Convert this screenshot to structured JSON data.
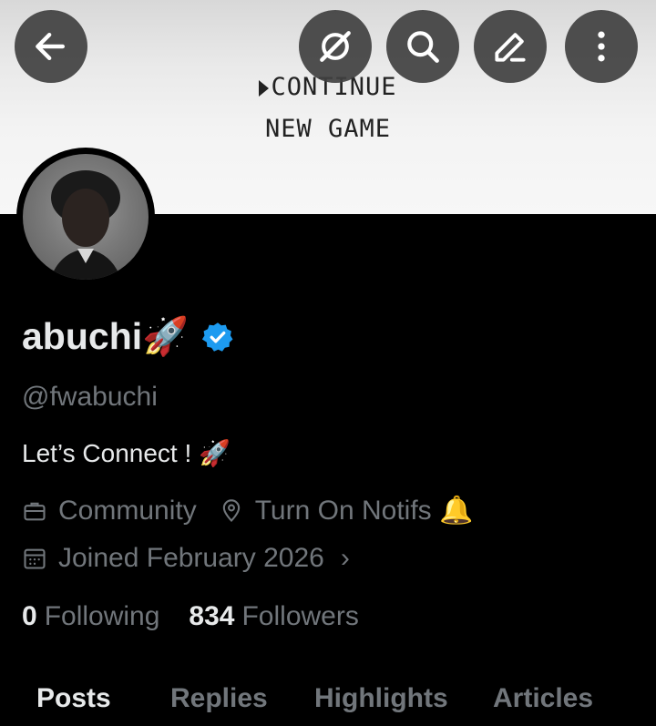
{
  "banner": {
    "line1": "CONTINUE",
    "line2": "NEW GAME"
  },
  "topbar": {
    "back_icon": "arrow-left-icon",
    "grok_icon": "grok-icon",
    "search_icon": "search-icon",
    "edit_icon": "pencil-icon",
    "more_icon": "more-vertical-icon"
  },
  "profile": {
    "name": "abuchi🚀",
    "handle": "@fwabuchi",
    "bio": "Let’s Connect ! 🚀",
    "category": "Community",
    "location": "Turn On Notifs 🔔",
    "joined": "Joined February 2026",
    "verified_color": "#1d9bf0"
  },
  "stats": {
    "following_count": "0",
    "following_label": "Following",
    "followers_count": "834",
    "followers_label": "Followers"
  },
  "tabs": [
    {
      "label": "Posts",
      "active": true
    },
    {
      "label": "Replies",
      "active": false
    },
    {
      "label": "Highlights",
      "active": false
    },
    {
      "label": "Articles",
      "active": false
    }
  ]
}
